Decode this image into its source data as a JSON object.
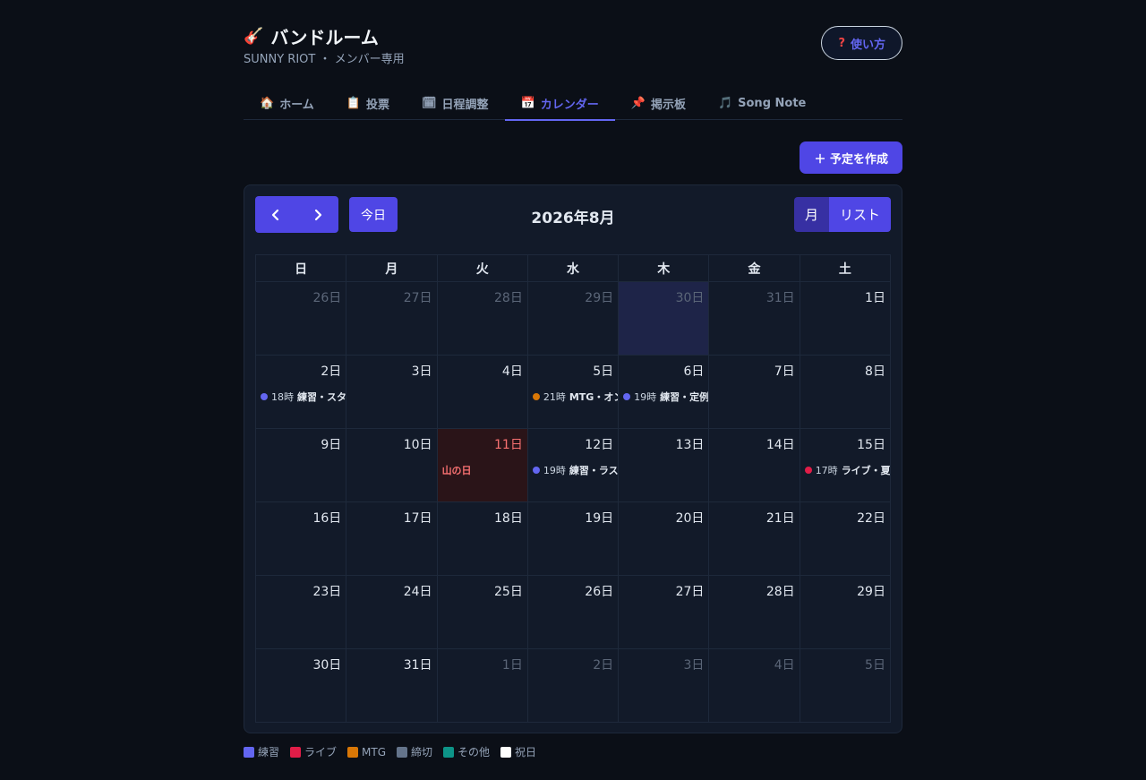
{
  "header": {
    "emoji": "🎸",
    "title": "バンドルーム",
    "subtitle": "SUNNY RIOT ・ メンバー専用",
    "help_label": "使い方",
    "help_icon": "?"
  },
  "tabs": [
    {
      "icon": "🏠",
      "label": "ホーム"
    },
    {
      "icon": "📋",
      "label": "投票"
    },
    {
      "icon": "🗓",
      "label": "日程調整"
    },
    {
      "icon": "📅",
      "label": "カレンダー",
      "active": true
    },
    {
      "icon": "📌",
      "label": "掲示板"
    },
    {
      "icon": "🎵",
      "label": "Song Note"
    }
  ],
  "create_label": "＋ 予定を作成",
  "calendar": {
    "title": "2026年8月",
    "prev_icon": "‹",
    "next_icon": "›",
    "today_label": "今日",
    "views": [
      {
        "label": "月",
        "active": true
      },
      {
        "label": "リスト",
        "active": false
      }
    ],
    "weekdays": [
      "日",
      "月",
      "火",
      "水",
      "木",
      "金",
      "土"
    ],
    "weeks": [
      [
        {
          "label": "26日",
          "other": true
        },
        {
          "label": "27日",
          "other": true
        },
        {
          "label": "28日",
          "other": true
        },
        {
          "label": "29日",
          "other": true
        },
        {
          "label": "30日",
          "other": true,
          "today": true
        },
        {
          "label": "31日",
          "other": true
        },
        {
          "label": "1日"
        }
      ],
      [
        {
          "label": "2日",
          "event": {
            "time": "18時",
            "title": "練習・スタジオ",
            "color": "#6366f1"
          }
        },
        {
          "label": "3日"
        },
        {
          "label": "4日"
        },
        {
          "label": "5日",
          "event": {
            "time": "21時",
            "title": "MTG・オンライン",
            "color": "#d97706"
          }
        },
        {
          "label": "6日",
          "event": {
            "time": "19時",
            "title": "練習・定例",
            "color": "#6366f1"
          }
        },
        {
          "label": "7日"
        },
        {
          "label": "8日"
        }
      ],
      [
        {
          "label": "9日"
        },
        {
          "label": "10日"
        },
        {
          "label": "11日",
          "holiday": "山の日"
        },
        {
          "label": "12日",
          "event": {
            "time": "19時",
            "title": "練習・ラスト",
            "color": "#6366f1"
          }
        },
        {
          "label": "13日"
        },
        {
          "label": "14日"
        },
        {
          "label": "15日",
          "event": {
            "time": "17時",
            "title": "ライブ・夏",
            "color": "#e11d48"
          }
        }
      ],
      [
        {
          "label": "16日"
        },
        {
          "label": "17日"
        },
        {
          "label": "18日"
        },
        {
          "label": "19日"
        },
        {
          "label": "20日"
        },
        {
          "label": "21日"
        },
        {
          "label": "22日"
        }
      ],
      [
        {
          "label": "23日"
        },
        {
          "label": "24日"
        },
        {
          "label": "25日"
        },
        {
          "label": "26日"
        },
        {
          "label": "27日"
        },
        {
          "label": "28日"
        },
        {
          "label": "29日"
        }
      ],
      [
        {
          "label": "30日"
        },
        {
          "label": "31日"
        },
        {
          "label": "1日",
          "other": true
        },
        {
          "label": "2日",
          "other": true
        },
        {
          "label": "3日",
          "other": true
        },
        {
          "label": "4日",
          "other": true
        },
        {
          "label": "5日",
          "other": true
        }
      ]
    ]
  },
  "legend": [
    {
      "label": "練習",
      "color": "#6366f1"
    },
    {
      "label": "ライブ",
      "color": "#e11d48"
    },
    {
      "label": "MTG",
      "color": "#d97706"
    },
    {
      "label": "締切",
      "color": "#64748b"
    },
    {
      "label": "その他",
      "color": "#0d9488"
    },
    {
      "label": "祝日",
      "color": "#ffffff"
    }
  ]
}
